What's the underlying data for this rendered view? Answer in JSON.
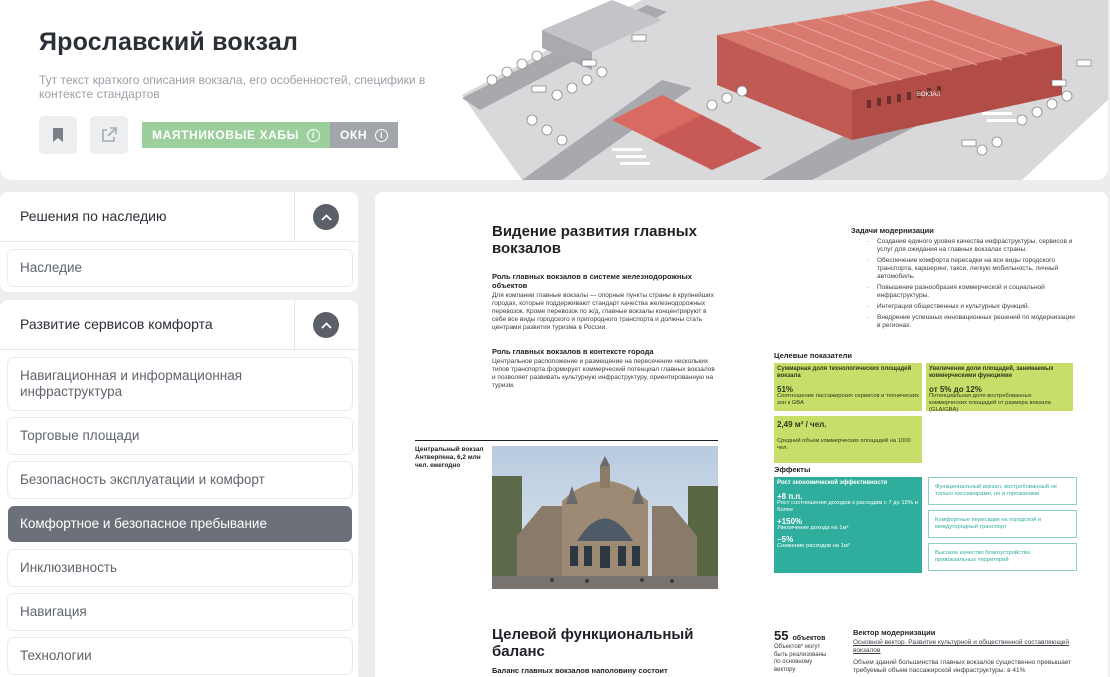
{
  "header": {
    "title": "Ярославский вокзал",
    "description": "Тут текст краткого описания вокзала, его особенностей, специфики в контексте стандартов",
    "tags": [
      {
        "label": "МАЯТНИКОВЫЕ ХАБЫ",
        "color": "#9dcf9c"
      },
      {
        "label": "ОКН",
        "color": "#a2a5aa"
      }
    ],
    "hero_labels": [
      "ВОКЗАЛ"
    ]
  },
  "sidebar": {
    "sections": [
      {
        "title": "Решения по наследию",
        "items": [
          {
            "label": "Наследие"
          }
        ]
      },
      {
        "title": "Развитие сервисов комфорта",
        "items": [
          {
            "label": "Навигационная и информационная инфраструктура"
          },
          {
            "label": "Торговые площади"
          },
          {
            "label": "Безопасность эксплуатации и комфорт"
          },
          {
            "label": "Комфортное и безопасное пребывание",
            "active": true
          },
          {
            "label": "Инклюзивность"
          },
          {
            "label": "Навигация"
          },
          {
            "label": "Технологии"
          }
        ]
      }
    ]
  },
  "document": {
    "heading": "Видение развития главных вокзалов",
    "sub1": "Роль главных вокзалов в системе железнодорожных объектов",
    "para1": "Для компании главные вокзалы — опорные пункты страны в крупнейших городах, которые поддерживают стандарт качества железнодорожных перевозок. Кроме перевозок по ж/д, главные вокзалы концентрируют в себе все виды городского и пригородного транспорта и должны стать центрами развития туризма в России.",
    "sub2": "Роль главных вокзалов в контексте города",
    "para2": "Центральное расположение и размещение на пересечении нескольких типов транспорта формирует коммерческий потенциал главных вокзалов и позволяет развивать культурную инфраструктуру, ориентированную на туризм.",
    "caption": "Центральный вокзал Антверпена, 6,2 млн чел. ежегодно",
    "tasks_title": "Задачи модернизации",
    "tasks": [
      "Создание единого уровня качества инфраструктуры, сервисов и услуг для ожидания на главных вокзалах страны.",
      "Обеспечение комфорта пересадки на все виды городского транспорта, каршеринг, такси, легкую мобильность, личный автомобиль.",
      "Повышение разнообразия коммерческой и социальной инфраструктуры.",
      "Интеграция общественных и культурных функций.",
      "Внедрение успешных инновационных решений по модернизации в регионах."
    ],
    "targets_title": "Целевые показатели",
    "kpi1_title": "Суммарная доля технологических площадей вокзала",
    "kpi1_value": "51%",
    "kpi1_text": "Соотношение пассажирских сервисов и технических зон к GBA",
    "kpi2_title": "Увеличение доли площадей, занимаемых коммерческими функциями",
    "kpi2_value": "от 5% до 12%",
    "kpi2_text": "Потенциальная доля востребованных коммерческих площадей от размера вокзала (GLA/GBA)",
    "kpi3_value": "2,49 м² / чел.",
    "kpi3_text": "Средний объем коммерческих площадей на 1000 чел.",
    "effects_title": "Эффекты",
    "eff_title": "Рост экономической эффективности",
    "eff1_value": "+8 п.п.",
    "eff1_text": "Рост соотношения доходов к расходам с 7 до 15% и более",
    "eff2_value": "+150%",
    "eff2_text": "Увеличение дохода на 1м²",
    "eff3_value": "−5%",
    "eff3_text": "Снижение расходов на 1м²",
    "out1": "Функциональный вокзал, востребованный не только пассажирами, но и горожанами",
    "out2": "Комфортные пересадки на городской и междугородный транспорт",
    "out3": "Высокое качество благоустройства привокзальных территорий",
    "heading2": "Целевой функциональный баланс",
    "sub3": "Баланс главных вокзалов наполовину состоит",
    "count_value": "55",
    "count_unit": "объектов",
    "count_text": "Объектов* могут быть реализованы по основному вектору",
    "vector_title": "Вектор модернизации",
    "vector_link": "Основной вектор. Развитие культурной и общественной составляющей вокзалов",
    "vector_text": "Объем зданий большинства главных вокзалов существенно превышает требуемый объем пассажирской инфраструктуры: в 41%"
  }
}
